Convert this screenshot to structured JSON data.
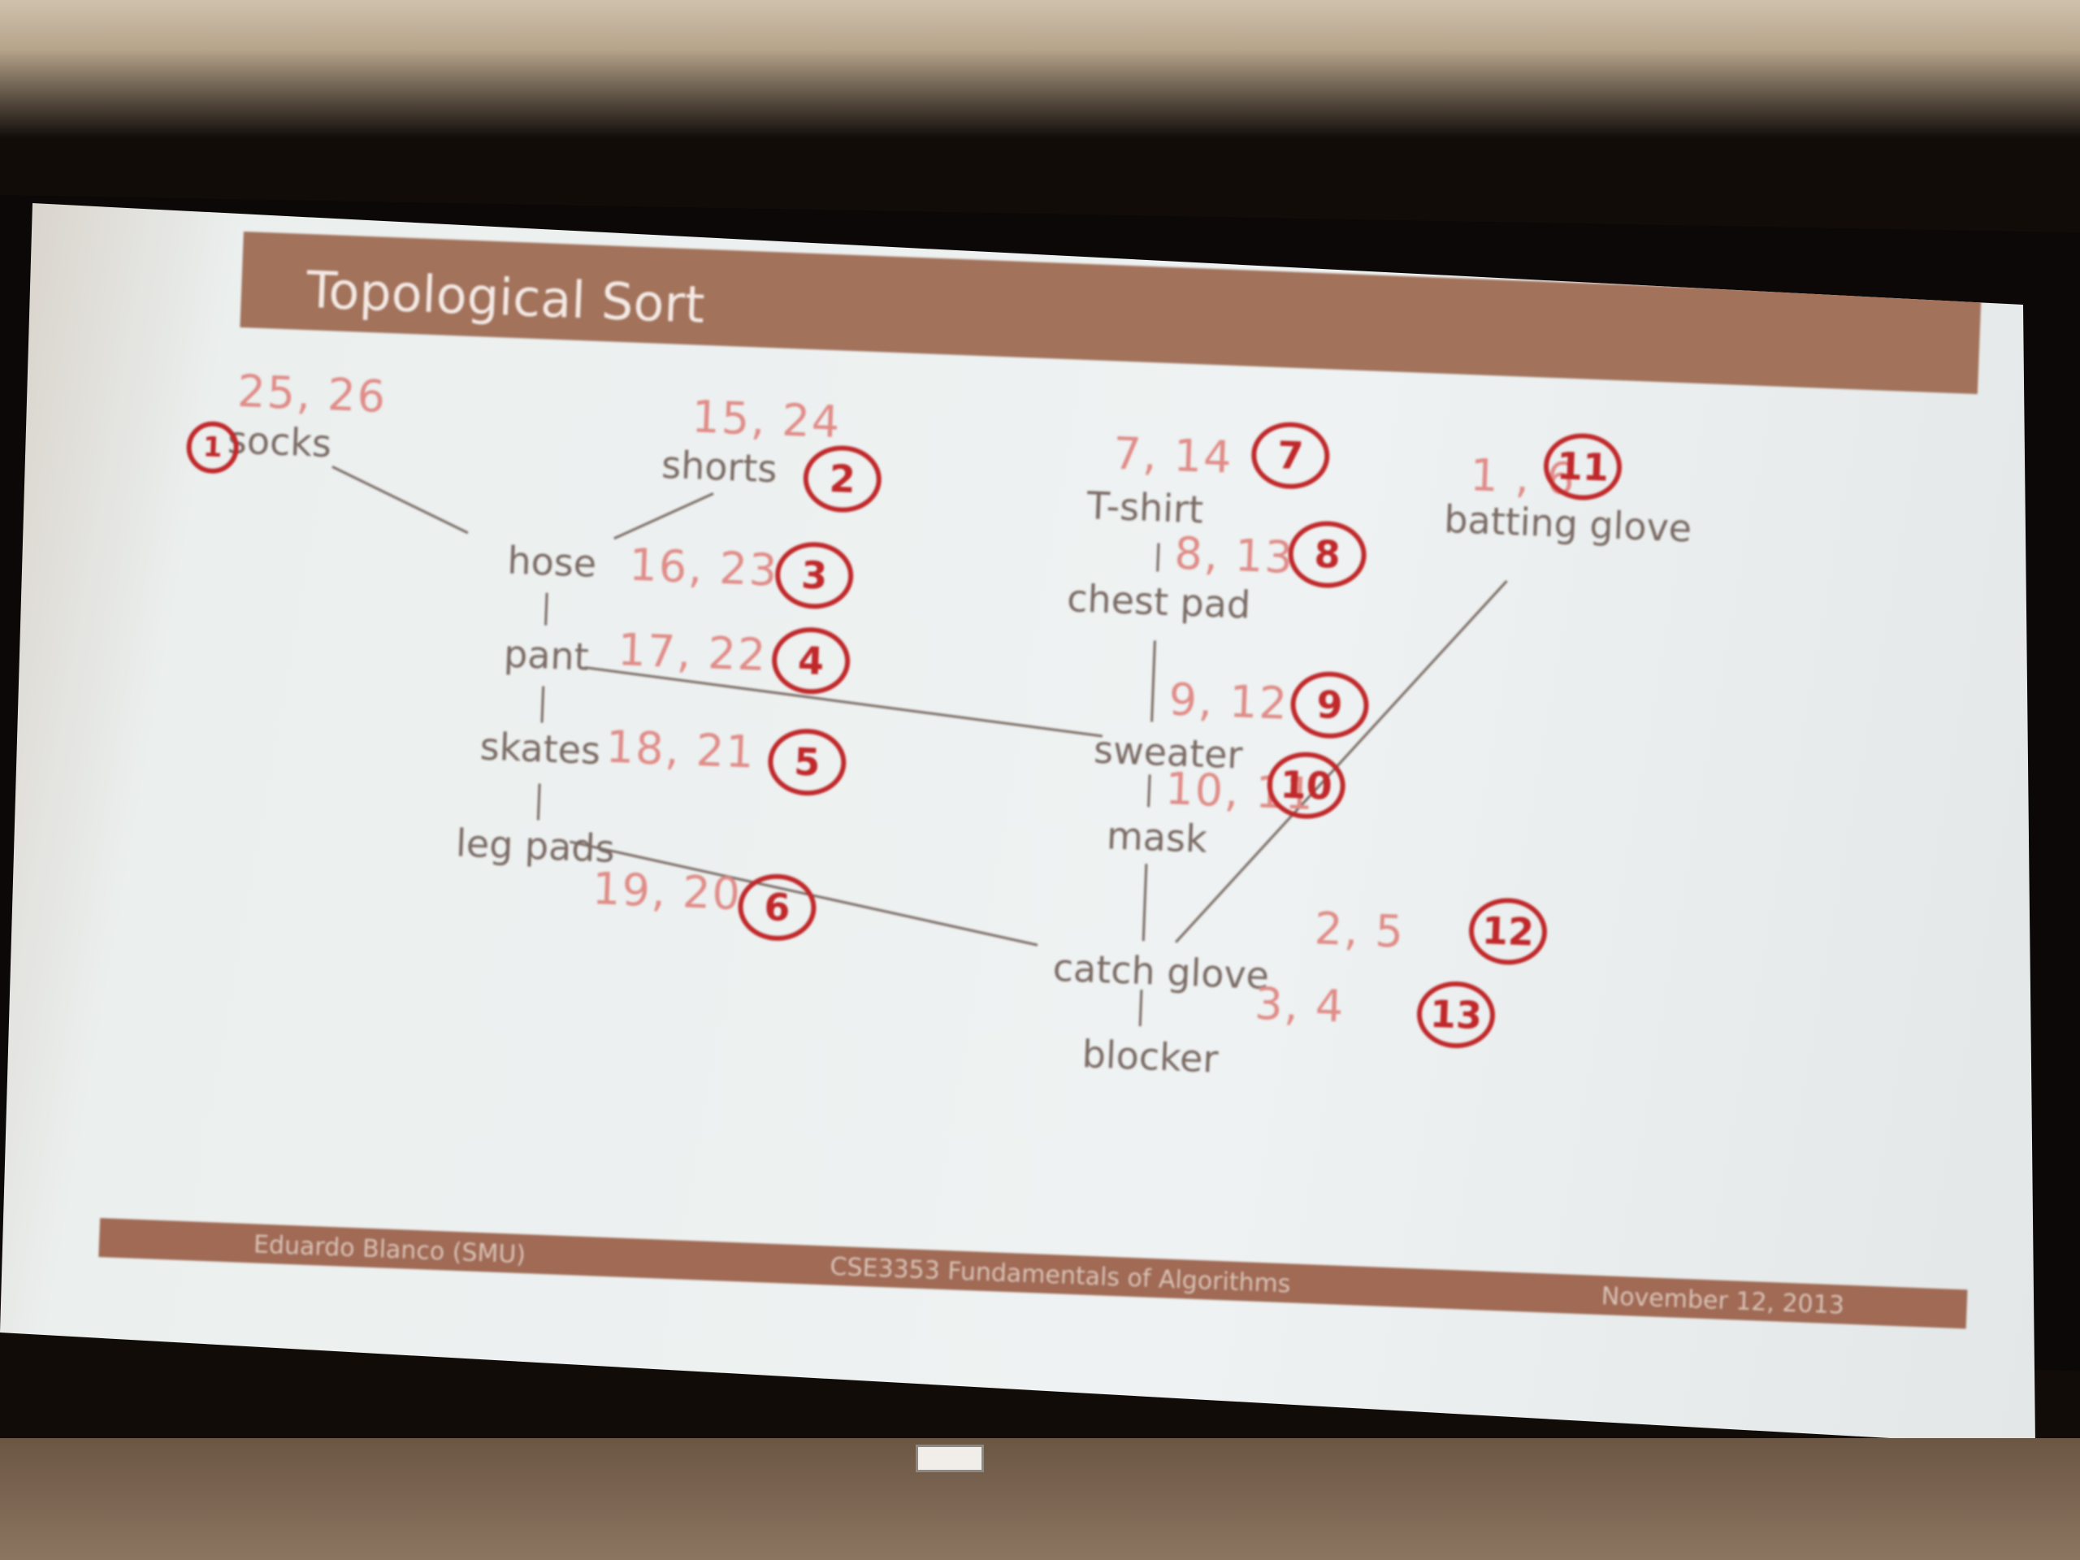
{
  "slide": {
    "title": "Topological Sort",
    "nodes": {
      "socks": "socks",
      "shorts": "shorts",
      "tshirt": "T-shirt",
      "batting_glove": "batting glove",
      "hose": "hose",
      "chest_pad": "chest pad",
      "pant": "pant",
      "sweater": "sweater",
      "skates": "skates",
      "mask": "mask",
      "leg_pads": "leg pads",
      "catch_glove": "catch glove",
      "blocker": "blocker"
    },
    "times": {
      "socks": "25, 26",
      "shorts": "15, 24",
      "tshirt": "7, 14",
      "batting_glove": "1 , 6",
      "hose": "16, 23",
      "chest_pad": "8, 13",
      "pant": "17, 22",
      "sweater": "9, 12",
      "skates": "18, 21",
      "mask": "10, 11",
      "leg_pads": "19, 20",
      "catch_glove": "2, 5",
      "blocker": "3, 4"
    },
    "order": {
      "socks": "1",
      "shorts": "2",
      "hose": "3",
      "pant": "4",
      "skates": "5",
      "leg_pads": "6",
      "tshirt": "7",
      "chest_pad": "8",
      "sweater": "9",
      "mask": "10",
      "batting_glove": "11",
      "catch_glove": "12",
      "blocker": "13"
    },
    "footer": {
      "author": "Eduardo Blanco (SMU)",
      "course": "CSE3353 Fundamentals of Algorithms",
      "date": "November 12, 2013"
    }
  },
  "colors": {
    "title_bar": "#a2725b",
    "slide_background": "#eef2f2",
    "node_text": "#7a6a64",
    "pen_light": "#e08c88",
    "pen_circle": "#c0282a"
  }
}
